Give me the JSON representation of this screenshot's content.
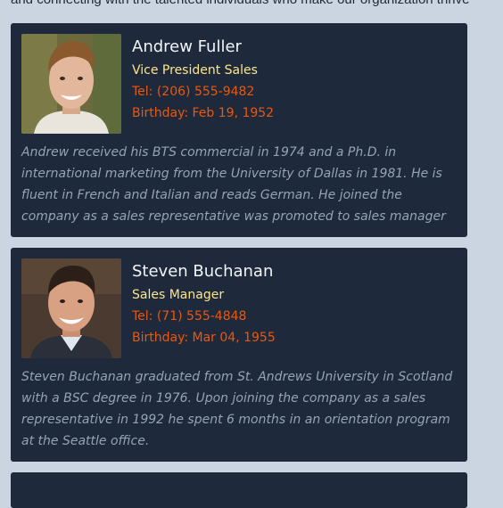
{
  "intro_text": "and connecting with the talented individuals who make our organization thrive",
  "employees": [
    {
      "name": "Andrew Fuller",
      "title": "Vice President Sales",
      "tel": "Tel: (206) 555-9482",
      "birthday": "Birthday: Feb 19, 1952",
      "notes": "Andrew received his BTS commercial in 1974 and a Ph.D. in international marketing from the University of Dallas in 1981. He is fluent in French and Italian and reads German. He joined the company as a sales representative was promoted to sales manager"
    },
    {
      "name": "Steven Buchanan",
      "title": "Sales Manager",
      "tel": "Tel: (71) 555-4848",
      "birthday": "Birthday: Mar 04, 1955",
      "notes": "Steven Buchanan graduated from St. Andrews University in Scotland with a BSC degree in 1976. Upon joining the company as a sales representative in 1992 he spent 6 months in an orientation program at the Seattle office."
    }
  ]
}
